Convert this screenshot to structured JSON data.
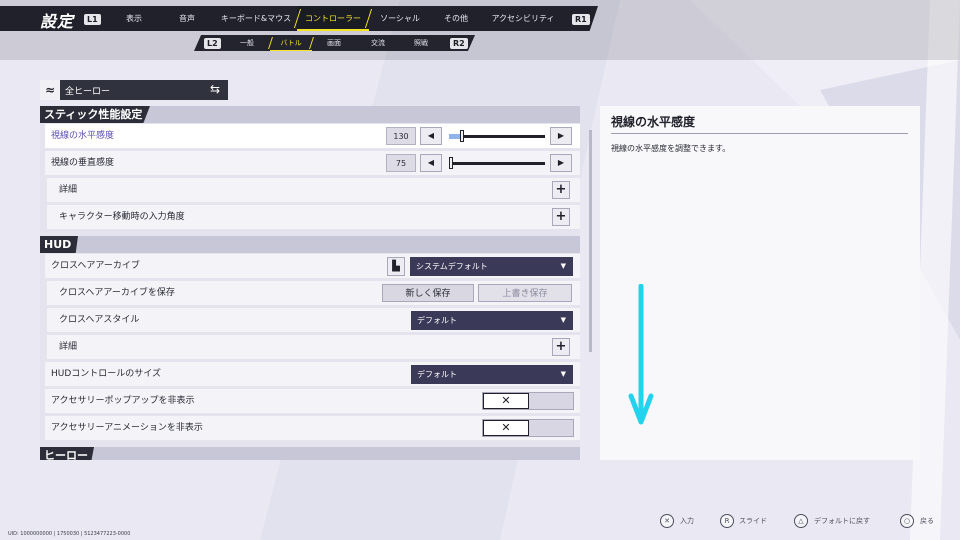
{
  "header": {
    "title": "設定",
    "left_button": "L1",
    "right_button": "R1",
    "tabs": [
      "表示",
      "音声",
      "キーボード&マウス",
      "コントローラー",
      "ソーシャル",
      "その他",
      "アクセシビリティ"
    ],
    "active_tab": "コントローラー"
  },
  "subheader": {
    "left_button": "L2",
    "right_button": "R2",
    "tabs": [
      "一般",
      "バトル",
      "画面",
      "交流",
      "照戦"
    ],
    "active_tab": "バトル"
  },
  "hero_selector": {
    "label": "全ヒーロー",
    "swap_icon": "⇆",
    "icon": "≈"
  },
  "sections": {
    "stick": "スティック性能設定",
    "hud": "HUD",
    "hero": "ヒーロー"
  },
  "rows": {
    "horizontal_sensitivity": {
      "label": "視線の水平感度",
      "value": "130",
      "slider_fraction": 0.14
    },
    "vertical_sensitivity": {
      "label": "視線の垂直感度",
      "value": "75",
      "slider_fraction": 0.0
    },
    "details1": {
      "label": "詳細"
    },
    "move_input_angle": {
      "label": "キャラクター移動時の入力角度"
    },
    "crosshair_archive": {
      "label": "クロスヘアアーカイブ",
      "value": "システムデフォルト"
    },
    "save_crosshair": {
      "label": "クロスヘアアーカイブを保存",
      "new_save": "新しく保存",
      "overwrite": "上書き保存"
    },
    "crosshair_style": {
      "label": "クロスヘアスタイル",
      "value": "デフォルト"
    },
    "details2": {
      "label": "詳細"
    },
    "hud_control_size": {
      "label": "HUDコントロールのサイズ",
      "value": "デフォルト"
    },
    "hide_accessory_popup": {
      "label": "アクセサリーポップアップを非表示",
      "toggle": "✕"
    },
    "hide_accessory_anim": {
      "label": "アクセサリーアニメーションを非表示",
      "toggle": "✕"
    }
  },
  "info_panel": {
    "title": "視線の水平感度",
    "description": "視線の水平感度を調整できます。"
  },
  "footer": {
    "hints": [
      {
        "icon": "✕",
        "label": "入力"
      },
      {
        "icon": "R",
        "label": "スライド"
      },
      {
        "icon": "△",
        "label": "デフォルトに戻す"
      },
      {
        "icon": "○",
        "label": "戻る"
      }
    ],
    "uid": "UID: 1000000000 | 1750030 | 5123477223-0000"
  },
  "colors": {
    "accent": "#f3e226",
    "dark": "#20212b",
    "selected_text": "#5b4fb8",
    "arrow": "#22d3ee"
  }
}
